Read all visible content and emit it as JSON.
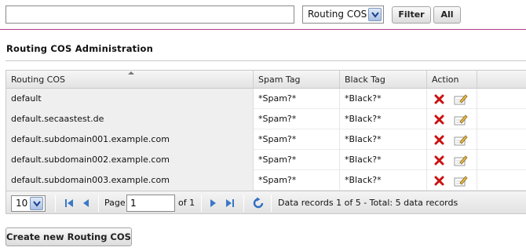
{
  "filter": {
    "search_value": "",
    "cos_select": "Routing COS",
    "filter_label": "Filter",
    "all_label": "All"
  },
  "page": {
    "title": "Routing COS Administration"
  },
  "grid": {
    "columns": [
      "Routing COS",
      "Spam Tag",
      "Black Tag",
      "Action"
    ],
    "rows": [
      {
        "cos": "default",
        "spam": "*Spam?*",
        "black": "*Black?*"
      },
      {
        "cos": "default.secaastest.de",
        "spam": "*Spam?*",
        "black": "*Black?*"
      },
      {
        "cos": "default.subdomain001.example.com",
        "spam": "*Spam?*",
        "black": "*Black?*"
      },
      {
        "cos": "default.subdomain002.example.com",
        "spam": "*Spam?*",
        "black": "*Black?*"
      },
      {
        "cos": "default.subdomain003.example.com",
        "spam": "*Spam?*",
        "black": "*Black?*"
      }
    ],
    "icons": {
      "delete": "delete-icon",
      "edit": "edit-icon",
      "sort": "sort-ascending-icon"
    },
    "colors": {
      "delete": "#cc1111",
      "accent_rule": "#b03a8a"
    }
  },
  "pager": {
    "page_size": "10",
    "page_label": "Page",
    "page_value": "1",
    "of_label": "of 1",
    "records_text": "Data records 1 of 5 - Total: 5 data records"
  },
  "footer": {
    "create_label": "Create new Routing COS"
  }
}
